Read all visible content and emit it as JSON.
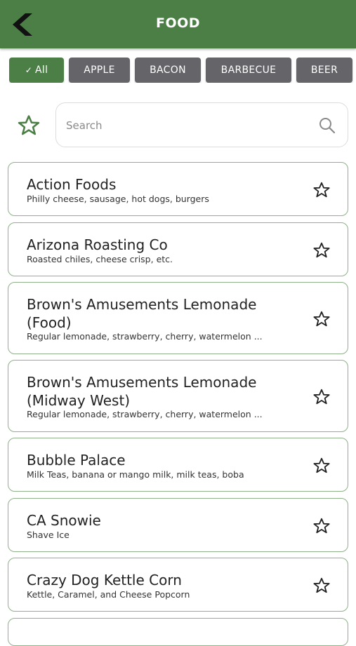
{
  "header": {
    "title": "FOOD",
    "back_icon": "chevron-left-icon"
  },
  "categories": [
    {
      "label": "All",
      "selected": true
    },
    {
      "label": "APPLE",
      "selected": false
    },
    {
      "label": "BACON",
      "selected": false
    },
    {
      "label": "BARBECUE",
      "selected": false
    },
    {
      "label": "BEER",
      "selected": false
    }
  ],
  "search": {
    "placeholder": "Search",
    "value": ""
  },
  "vendors": [
    {
      "name": "Action Foods",
      "description": "Philly cheese, sausage, hot dogs, burgers"
    },
    {
      "name": "Arizona Roasting Co",
      "description": "Roasted chiles, cheese crisp, etc."
    },
    {
      "name": "Brown's Amusements Lemonade (Food)",
      "description": "Regular lemonade, strawberry, cherry, watermelon ..."
    },
    {
      "name": "Brown's Amusements Lemonade (Midway West)",
      "description": "Regular lemonade, strawberry, cherry, watermelon ..."
    },
    {
      "name": "Bubble Palace",
      "description": "Milk Teas, banana or mango milk, milk teas, boba"
    },
    {
      "name": "CA Snowie",
      "description": "Shave Ice"
    },
    {
      "name": "Crazy Dog Kettle Corn",
      "description": "Kettle, Caramel, and Cheese Popcorn"
    }
  ],
  "colors": {
    "brand": "#4b7f46",
    "chip": "#646469",
    "card_border": "#8fb08a"
  }
}
